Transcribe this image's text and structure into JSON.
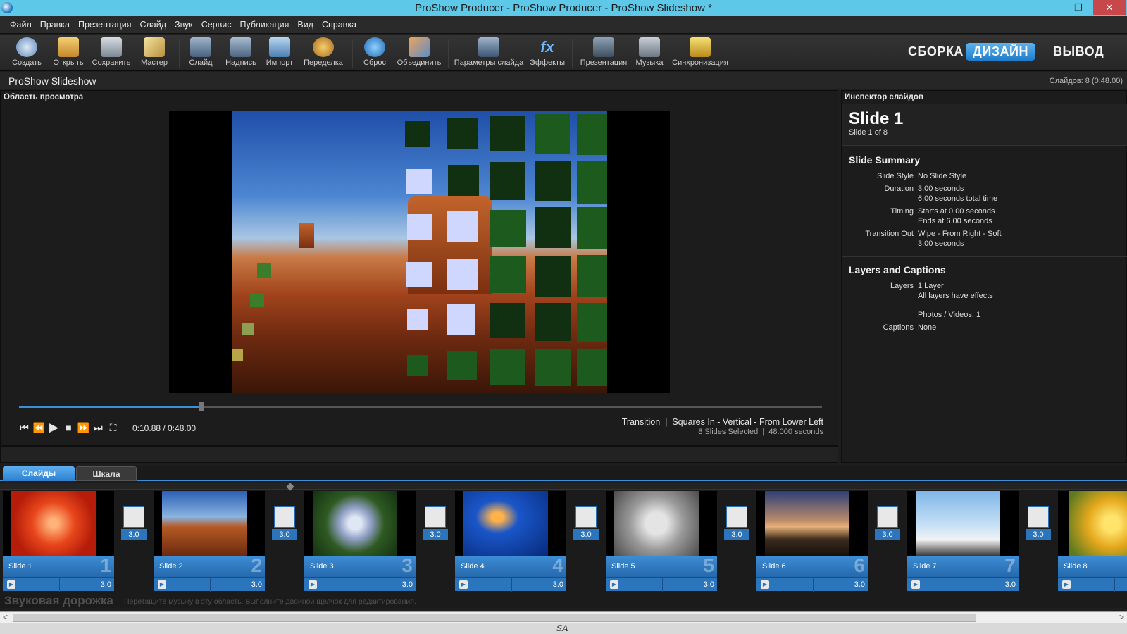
{
  "window": {
    "title": "ProShow Producer - ProShow Producer - ProShow Slideshow *",
    "minimize": "–",
    "restore": "❐",
    "close": "✕"
  },
  "menu": [
    "Файл",
    "Правка",
    "Презентация",
    "Слайд",
    "Звук",
    "Сервис",
    "Публикация",
    "Вид",
    "Справка"
  ],
  "toolbar": {
    "buttons": [
      "Создать",
      "Открыть",
      "Сохранить",
      "Мастер",
      "Слайд",
      "Надпись",
      "Импорт",
      "Переделка",
      "Сброс",
      "Объединить",
      "Параметры слайда",
      "Эффекты",
      "Презентация",
      "Музыка",
      "Синхронизация"
    ],
    "modes": {
      "build": "СБОРКА",
      "design": "ДИЗАЙН",
      "output": "ВЫВОД"
    }
  },
  "project": {
    "name": "ProShow Slideshow",
    "info": "Слайдов: 8 (0:48.00)"
  },
  "preview": {
    "title": "Область просмотра",
    "progress": 0.227,
    "timecode": "0:10.88 / 0:48.00",
    "transition_line": "Transition  |  Squares In - Vertical - From Lower Left",
    "selection_line": "8 Slides Selected  |  48.000 seconds"
  },
  "inspector": {
    "title": "Инспектор слайдов",
    "slide_title": "Slide 1",
    "slide_sub": "Slide 1 of 8",
    "summary_heading": "Slide Summary",
    "slide_style_label": "Slide Style",
    "slide_style_value": "No Slide Style",
    "duration_label": "Duration",
    "duration_value": "3.00 seconds",
    "duration_total": "6.00 seconds total time",
    "timing_label": "Timing",
    "timing_start": "Starts at 0.00 seconds",
    "timing_end": "Ends at 6.00 seconds",
    "transition_label": "Transition Out",
    "transition_value": "Wipe - From Right - Soft",
    "transition_duration": "3.00 seconds",
    "layers_heading": "Layers and Captions",
    "layers_label": "Layers",
    "layers_value": "1 Layer",
    "layers_effects": "All layers have effects",
    "photos_videos": "Photos / Videos: 1",
    "captions_label": "Captions",
    "captions_value": "None"
  },
  "tabs": {
    "slides": "Слайды",
    "timeline": "Шкала"
  },
  "slides": [
    {
      "name": "Slide 1",
      "num": "1",
      "dur": "3.0",
      "play": "▶"
    },
    {
      "name": "Slide 2",
      "num": "2",
      "dur": "3.0",
      "play": "▶"
    },
    {
      "name": "Slide 3",
      "num": "3",
      "dur": "3.0",
      "play": "▶"
    },
    {
      "name": "Slide 4",
      "num": "4",
      "dur": "3.0",
      "play": "▶"
    },
    {
      "name": "Slide 5",
      "num": "5",
      "dur": "3.0",
      "play": "▶"
    },
    {
      "name": "Slide 6",
      "num": "6",
      "dur": "3.0",
      "play": "▶"
    },
    {
      "name": "Slide 7",
      "num": "7",
      "dur": "3.0",
      "play": "▶"
    },
    {
      "name": "Slide 8",
      "num": "",
      "dur": "",
      "play": "▶"
    }
  ],
  "transitions": [
    "3.0",
    "3.0",
    "3.0",
    "3.0",
    "3.0",
    "3.0",
    "3.0"
  ],
  "audio": {
    "title": "Звуковая дорожка",
    "hint": "Перетащите музыку в эту область. Выполните двойной щелчок для редактирования."
  },
  "watermark": "SA",
  "colors": {
    "accent": "#3a8fd8",
    "titlebar": "#5ec8e8",
    "link": "#6db1f0"
  }
}
